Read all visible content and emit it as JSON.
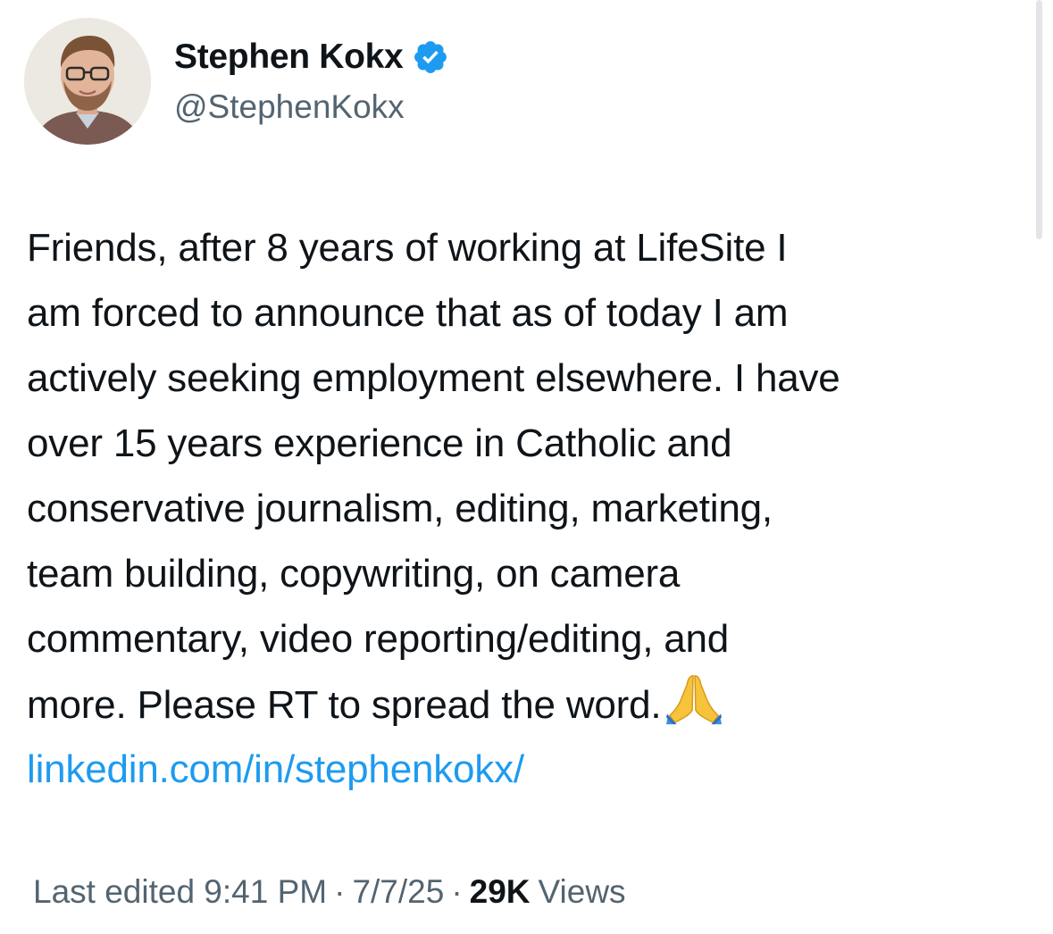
{
  "author": {
    "display_name": "Stephen Kokx",
    "handle": "@StephenKokx",
    "verified": true,
    "verified_color": "#1d9bf0"
  },
  "tweet": {
    "lines": [
      "Friends, after 8 years of working at LifeSite I",
      "am forced to announce that as of today I am",
      "actively seeking employment elsewhere. I have",
      "over 15 years experience in Catholic and",
      "conservative journalism, editing, marketing,",
      "team building, copywriting, on camera",
      "commentary, video reporting/editing, and",
      "more. Please RT to spread the word."
    ],
    "emoji": "folded-hands-icon",
    "link_text": "linkedin.com/in/stephenkokx/",
    "link_color": "#1d9bf0"
  },
  "meta": {
    "edited_label": "Last edited 9:41 PM",
    "separator": "·",
    "date": "7/7/25",
    "views_count": "29K",
    "views_label": "Views"
  },
  "colors": {
    "text_primary": "#0f1419",
    "text_secondary": "#536471",
    "background": "#ffffff"
  }
}
